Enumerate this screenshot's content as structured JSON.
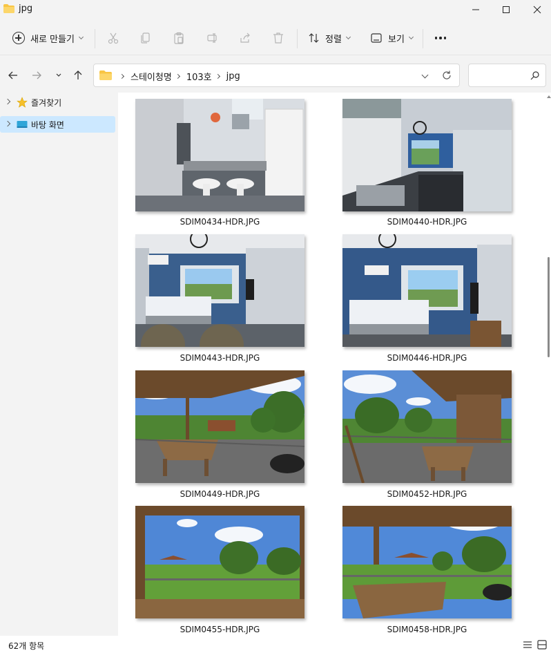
{
  "window": {
    "title": "jpg"
  },
  "toolbar": {
    "new_label": "새로 만들기",
    "sort_label": "정렬",
    "view_label": "보기"
  },
  "address": {
    "crumbs": [
      "스테이청명",
      "103호",
      "jpg"
    ]
  },
  "search": {
    "placeholder": ""
  },
  "sidebar": {
    "items": [
      {
        "label": "즐겨찾기"
      },
      {
        "label": "바탕 화면"
      }
    ]
  },
  "files": [
    {
      "name": "SDIM0434-HDR.JPG",
      "scene": "kitchen"
    },
    {
      "name": "SDIM0440-HDR.JPG",
      "scene": "kitchen-room"
    },
    {
      "name": "SDIM0443-HDR.JPG",
      "scene": "bedroom"
    },
    {
      "name": "SDIM0446-HDR.JPG",
      "scene": "bedroom"
    },
    {
      "name": "SDIM0449-HDR.JPG",
      "scene": "deck"
    },
    {
      "name": "SDIM0452-HDR.JPG",
      "scene": "deck"
    },
    {
      "name": "SDIM0455-HDR.JPG",
      "scene": "deck-view"
    },
    {
      "name": "SDIM0458-HDR.JPG",
      "scene": "deck-view"
    }
  ],
  "status": {
    "item_count": "62개 항목"
  },
  "colors": {
    "selection": "#cce8ff",
    "folder": "#f8c544",
    "accent": "#0067c0"
  }
}
